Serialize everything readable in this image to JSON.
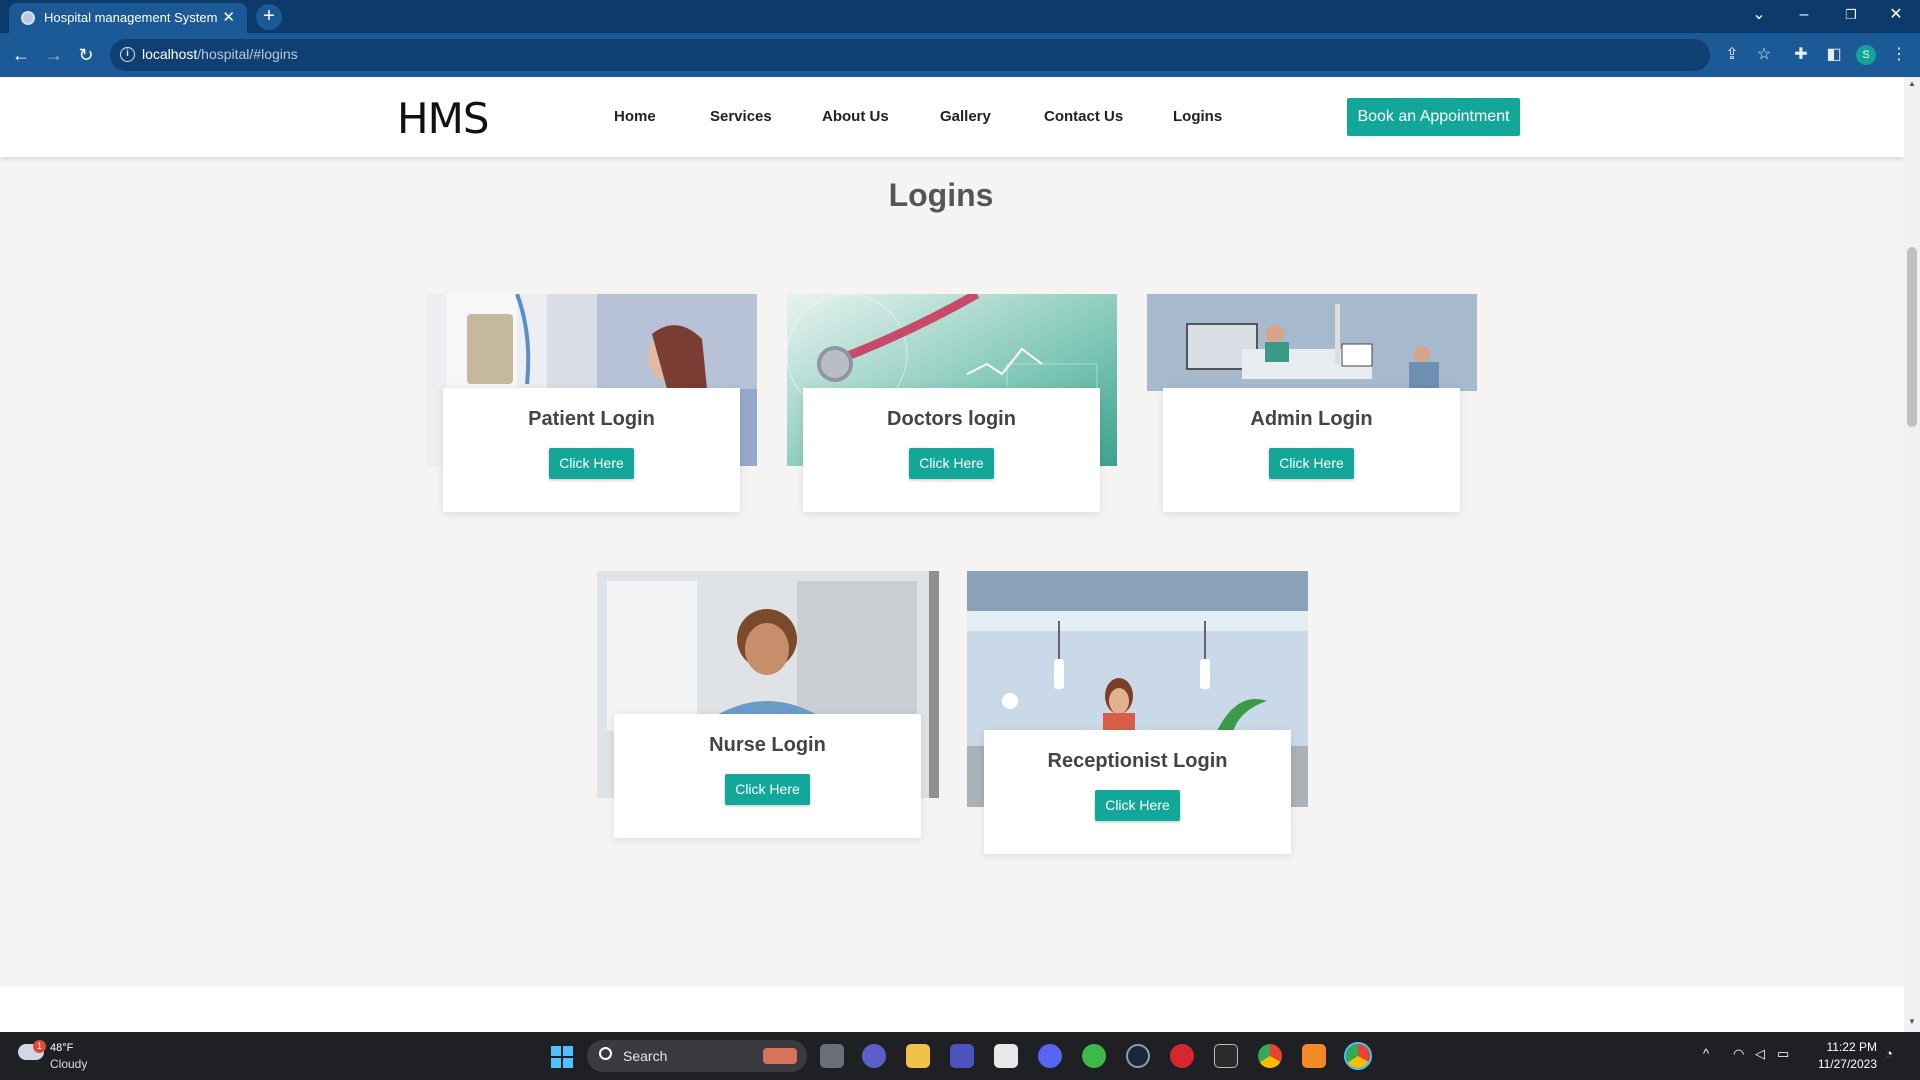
{
  "browser": {
    "tab_title": "Hospital management System",
    "tab_close": "✕",
    "new_tab": "+",
    "url_host": "localhost",
    "url_path": "/hospital/#logins",
    "avatar_letter": "S"
  },
  "header": {
    "logo": "HMS",
    "nav": [
      "Home",
      "Services",
      "About Us",
      "Gallery",
      "Contact Us",
      "Logins"
    ],
    "cta": "Book an Appointment"
  },
  "section": {
    "title": "Logins"
  },
  "cards": [
    {
      "title": "Patient Login",
      "button": "Click Here"
    },
    {
      "title": "Doctors login",
      "button": "Click Here"
    },
    {
      "title": "Admin Login",
      "button": "Click Here"
    },
    {
      "title": "Nurse Login",
      "button": "Click Here"
    },
    {
      "title": "Receptionist Login",
      "button": "Click Here"
    }
  ],
  "taskbar": {
    "weather_temp": "48°F",
    "weather_cond": "Cloudy",
    "weather_badge": "1",
    "search_label": "Search",
    "time": "11:22 PM",
    "date": "11/27/2023"
  },
  "colors": {
    "accent": "#13a79a",
    "chrome": "#1b5a96",
    "tabstrip": "#0b3a6b"
  }
}
